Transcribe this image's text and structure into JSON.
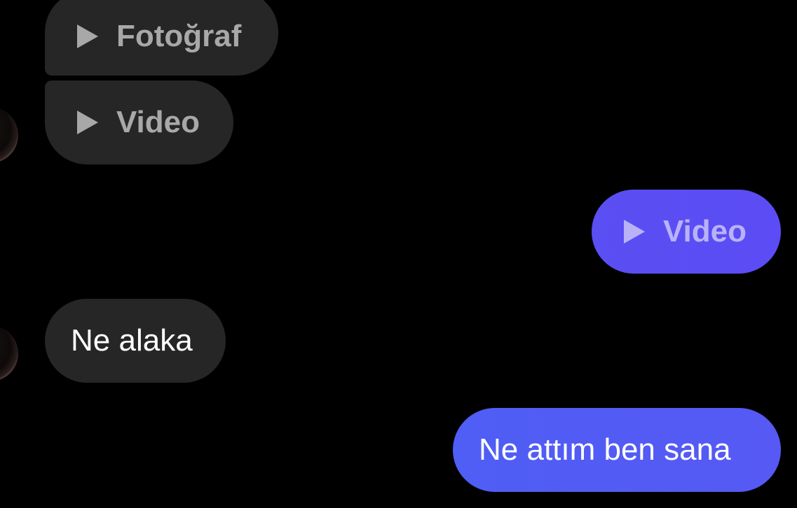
{
  "messages": [
    {
      "direction": "incoming",
      "kind": "media",
      "label": "Fotoğraf",
      "icon": "play-icon"
    },
    {
      "direction": "incoming",
      "kind": "media",
      "label": "Video",
      "icon": "play-icon"
    },
    {
      "direction": "outgoing",
      "kind": "media",
      "label": "Video",
      "icon": "play-icon"
    },
    {
      "direction": "incoming",
      "kind": "text",
      "text": "Ne alaka"
    },
    {
      "direction": "outgoing",
      "kind": "text",
      "text": "Ne attım ben sana"
    }
  ],
  "colors": {
    "background": "#000000",
    "incoming_bubble": "#262626",
    "outgoing_bubble": "#5659f4",
    "media_label_incoming": "#a8a8a8",
    "media_label_outgoing": "#b9b2f7"
  }
}
